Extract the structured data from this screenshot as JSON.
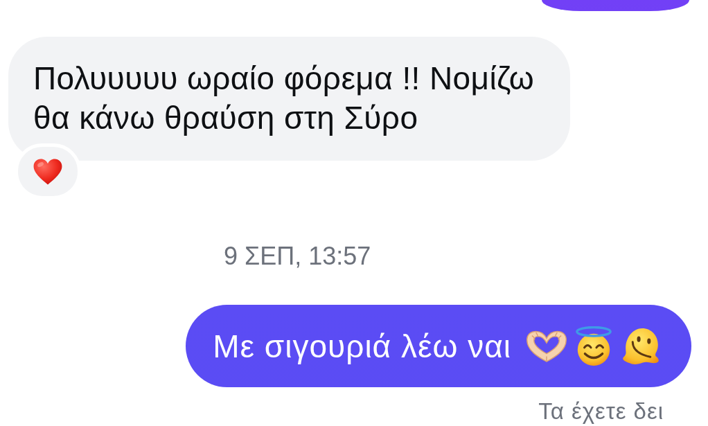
{
  "messages": [
    {
      "kind": "outgoing"
    },
    {
      "kind": "incoming",
      "text": "Πολυυυυυ ωραίο φόρεμα !! Νομίζω θα κάνω θραύση στη Σύρο",
      "reaction": {
        "kind": "heart"
      }
    },
    {
      "kind": "timestamp",
      "text": "9 ΣΕΠ, 13:57"
    },
    {
      "kind": "outgoing",
      "text": "Με σιγουριά λέω ναι",
      "emojis": [
        {
          "kind": "heart-hands"
        },
        {
          "kind": "halo-smile"
        },
        {
          "kind": "melting-face"
        }
      ]
    },
    {
      "kind": "receipt",
      "text": "Τα έχετε δει"
    }
  ]
}
